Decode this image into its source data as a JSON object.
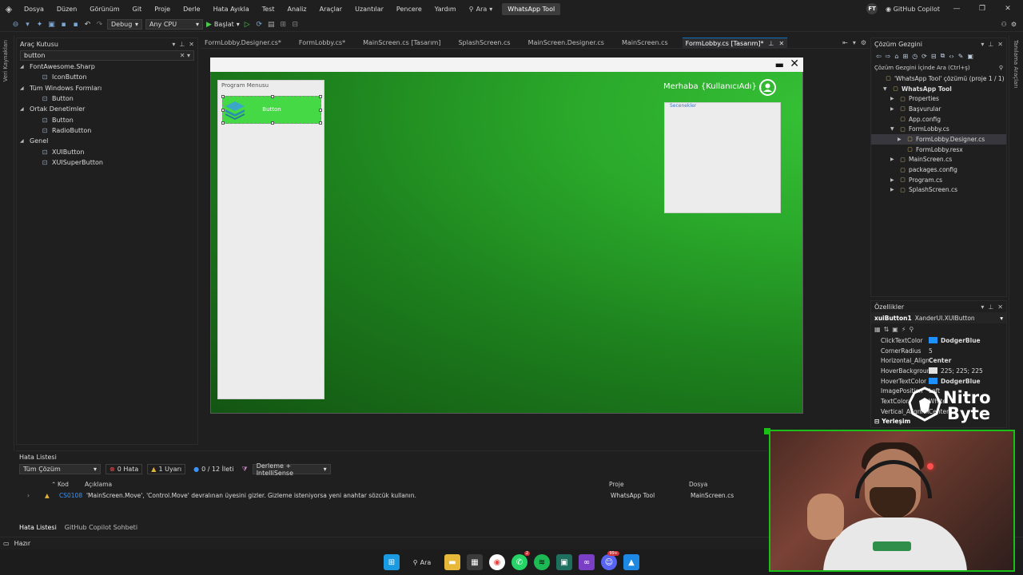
{
  "menubar": {
    "items": [
      "Dosya",
      "Düzen",
      "Görünüm",
      "Git",
      "Proje",
      "Derle",
      "Hata Ayıkla",
      "Test",
      "Analiz",
      "Araçlar",
      "Uzantılar",
      "Pencere",
      "Yardım"
    ],
    "search_label": "Ara",
    "app_title": "WhatsApp Tool",
    "user_initials": "FT",
    "copilot_label": "GitHub Copilot"
  },
  "toolbar": {
    "config": "Debug",
    "platform": "Any CPU",
    "start_label": "Başlat"
  },
  "left_strip_label": "Veri Kaynakları",
  "right_strip_label": "Tanılama Araçları",
  "toolbox": {
    "title": "Araç Kutusu",
    "search_value": "button",
    "tree": [
      {
        "label": "FontAwesome.Sharp",
        "level": 0
      },
      {
        "label": "IconButton",
        "level": 1
      },
      {
        "label": "Tüm Windows Formları",
        "level": 0
      },
      {
        "label": "Button",
        "level": 1
      },
      {
        "label": "Ortak Denetimler",
        "level": 0
      },
      {
        "label": "Button",
        "level": 1
      },
      {
        "label": "RadioButton",
        "level": 1
      },
      {
        "label": "Genel",
        "level": 0
      },
      {
        "label": "XUIButton",
        "level": 1
      },
      {
        "label": "XUISuperButton",
        "level": 1
      }
    ]
  },
  "doc_tabs": [
    {
      "label": "FormLobby.Designer.cs*",
      "active": false
    },
    {
      "label": "FormLobby.cs*",
      "active": false
    },
    {
      "label": "MainScreen.cs [Tasarım]",
      "active": false
    },
    {
      "label": "SplashScreen.cs",
      "active": false
    },
    {
      "label": "MainScreen.Designer.cs",
      "active": false
    },
    {
      "label": "MainScreen.cs",
      "active": false
    },
    {
      "label": "FormLobby.cs [Tasarım]*",
      "active": true
    }
  ],
  "designer": {
    "program_menu_label": "Program Menusu",
    "button_label": "Button",
    "greeting": "Merhaba {KullanıcıAdı} !",
    "options_label": "Secenekler",
    "form_gradient_light": "#36c236",
    "form_gradient_dark": "#135513",
    "button_color": "#46d946"
  },
  "solution": {
    "title": "Çözüm Gezgini",
    "search_placeholder": "Çözüm Gezgini İçinde Ara (Ctrl+ş)",
    "items": [
      {
        "label": "'WhatsApp Tool' çözümü (proje 1 / 1)",
        "level": 0,
        "bold": false,
        "selected": false,
        "tri": ""
      },
      {
        "label": "WhatsApp Tool",
        "level": 1,
        "bold": true,
        "selected": false,
        "tri": "▼"
      },
      {
        "label": "Properties",
        "level": 2,
        "bold": false,
        "selected": false,
        "tri": "▶"
      },
      {
        "label": "Başvurular",
        "level": 2,
        "bold": false,
        "selected": false,
        "tri": "▶"
      },
      {
        "label": "App.config",
        "level": 2,
        "bold": false,
        "selected": false,
        "tri": ""
      },
      {
        "label": "FormLobby.cs",
        "level": 2,
        "bold": false,
        "selected": false,
        "tri": "▼"
      },
      {
        "label": "FormLobby.Designer.cs",
        "level": 3,
        "bold": false,
        "selected": true,
        "tri": "▶"
      },
      {
        "label": "FormLobby.resx",
        "level": 3,
        "bold": false,
        "selected": false,
        "tri": ""
      },
      {
        "label": "MainScreen.cs",
        "level": 2,
        "bold": false,
        "selected": false,
        "tri": "▶"
      },
      {
        "label": "packages.config",
        "level": 2,
        "bold": false,
        "selected": false,
        "tri": ""
      },
      {
        "label": "Program.cs",
        "level": 2,
        "bold": false,
        "selected": false,
        "tri": "▶"
      },
      {
        "label": "SplashScreen.cs",
        "level": 2,
        "bold": false,
        "selected": false,
        "tri": "▶"
      }
    ]
  },
  "properties": {
    "title": "Özellikler",
    "object_name": "xuiButton1",
    "object_type": "XanderUI.XUIButton",
    "rows": [
      {
        "key": "ClickTextColor",
        "value": "DodgerBlue",
        "swatch": "#1e90ff",
        "bold": true
      },
      {
        "key": "CornerRadius",
        "value": "5",
        "swatch": "",
        "bold": false
      },
      {
        "key": "Horizontal_Alignm",
        "value": "Center",
        "swatch": "",
        "bold": true
      },
      {
        "key": "HoverBackground",
        "value": "225; 225; 225",
        "swatch": "#e1e1e1",
        "bold": false
      },
      {
        "key": "HoverTextColor",
        "value": "DodgerBlue",
        "swatch": "#1e90ff",
        "bold": true
      },
      {
        "key": "ImagePosition",
        "value": "Left",
        "swatch": "",
        "bold": false
      },
      {
        "key": "TextColor",
        "value": "White",
        "swatch": "",
        "bold": false
      },
      {
        "key": "Vertical_Alignment",
        "value": "Center",
        "swatch": "",
        "bold": false
      }
    ],
    "category": "Yerleşim"
  },
  "watermark": {
    "line1": "Nitro",
    "line2": "Byte"
  },
  "errors": {
    "title": "Hata Listesi",
    "scope": "Tüm Çözüm",
    "errors_count": "0 Hata",
    "warnings_count": "1 Uyarı",
    "messages_count": "0 / 12 İleti",
    "build_filter": "Derleme + IntelliSense",
    "col_code": "Kod",
    "col_desc": "Açıklama",
    "col_project": "Proje",
    "col_file": "Dosya",
    "row": {
      "code": "CS0108",
      "desc": "'MainScreen.Move', 'Control.Move' devralınan üyesini gizler. Gizleme isteniyorsa yeni anahtar sözcük kullanın.",
      "project": "WhatsApp Tool",
      "file": "MainScreen.cs"
    },
    "tab_errors": "Hata Listesi",
    "tab_copilot": "GitHub Copilot Sohbeti"
  },
  "status": {
    "text": "Hazır"
  },
  "taskbar": {
    "search_label": "Ara",
    "badges": {
      "whatsapp": "2",
      "discord": "99+"
    }
  }
}
